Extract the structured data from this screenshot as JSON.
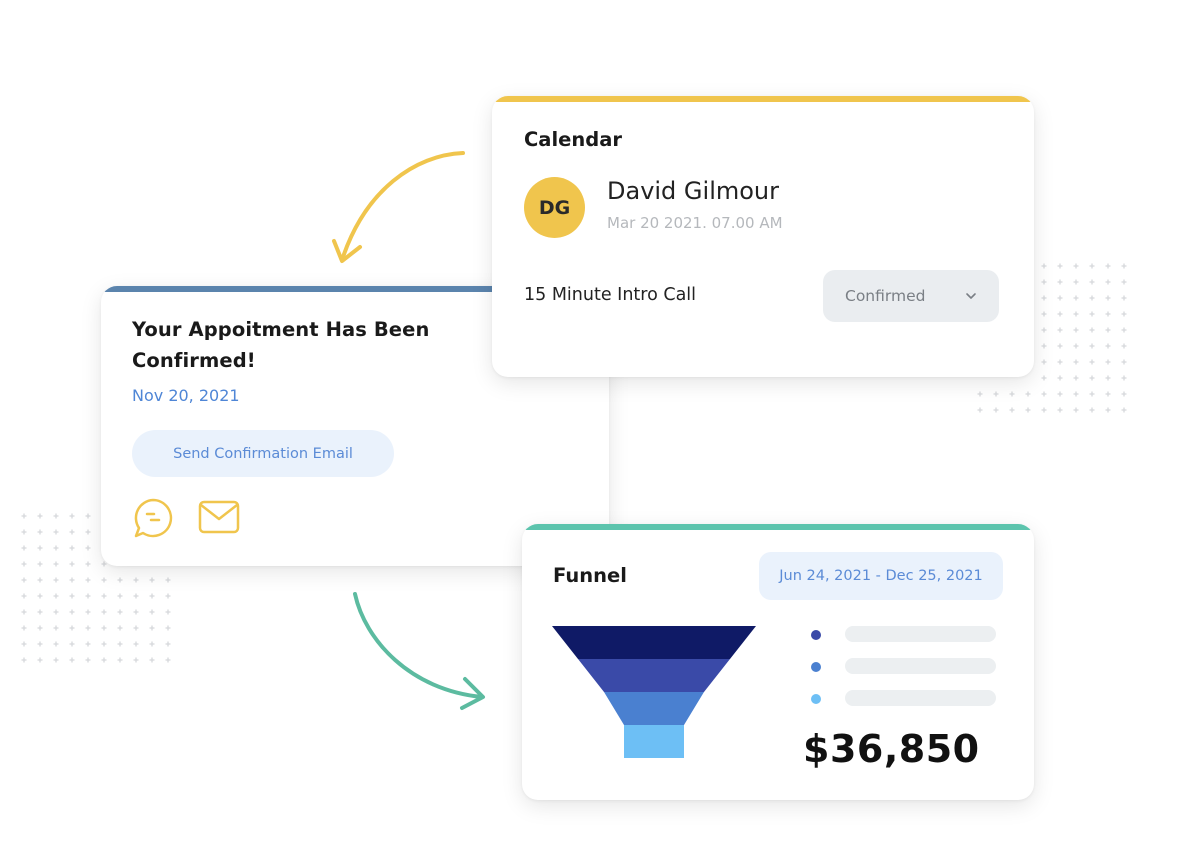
{
  "colors": {
    "calendar_accent": "#f0c54d",
    "appointment_accent": "#5b84ad",
    "funnel_accent": "#5cc4ad",
    "link_blue": "#4f86d6",
    "arrow_yellow": "#f0c54d",
    "arrow_teal": "#5cbba0"
  },
  "calendar": {
    "heading": "Calendar",
    "avatar_initials": "DG",
    "name": "David Gilmour",
    "datetime": "Mar 20 2021. 07.00 AM",
    "event": "15 Minute Intro Call",
    "status": {
      "selected": "Confirmed",
      "icon": "chevron-down-icon"
    }
  },
  "appointment": {
    "title": "Your Appoitment Has Been Confirmed!",
    "date": "Nov 20, 2021",
    "send_button": "Send Confirmation Email",
    "icons": [
      "chat-bubble-icon",
      "mail-icon"
    ]
  },
  "funnel": {
    "heading": "Funnel",
    "date_range": "Jun 24, 2021 -  Dec 25, 2021",
    "amount": "$36,850",
    "legend": [
      {
        "color": "#3a4aa8"
      },
      {
        "color": "#4a80d0"
      },
      {
        "color": "#6dbff5"
      }
    ]
  },
  "chart_data": {
    "type": "funnel",
    "title": "Funnel",
    "stages": [
      {
        "color": "#0f1a66"
      },
      {
        "color": "#3a4aa8"
      },
      {
        "color": "#4a80d0"
      },
      {
        "color": "#6dbff5"
      }
    ],
    "total_label": "$36,850"
  }
}
